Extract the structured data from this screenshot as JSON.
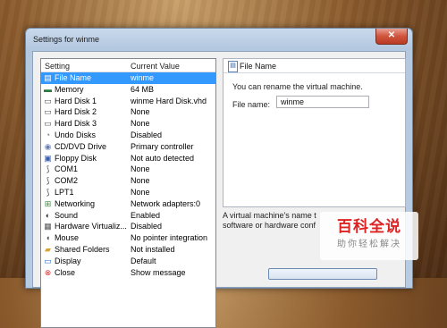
{
  "window": {
    "title": "Settings for winme",
    "close_label": "✕"
  },
  "list": {
    "headers": {
      "setting": "Setting",
      "value": "Current Value"
    },
    "rows": [
      {
        "label": "File Name",
        "value": "winme",
        "icon": "file-icon",
        "selected": true
      },
      {
        "label": "Memory",
        "value": "64 MB",
        "icon": "memory-icon"
      },
      {
        "label": "Hard Disk 1",
        "value": "winme Hard Disk.vhd",
        "icon": "hard-disk-icon"
      },
      {
        "label": "Hard Disk 2",
        "value": "None",
        "icon": "hard-disk-icon"
      },
      {
        "label": "Hard Disk 3",
        "value": "None",
        "icon": "hard-disk-icon"
      },
      {
        "label": "Undo Disks",
        "value": "Disabled",
        "icon": "undo-disk-icon"
      },
      {
        "label": "CD/DVD Drive",
        "value": "Primary controller",
        "icon": "cd-dvd-icon"
      },
      {
        "label": "Floppy Disk",
        "value": "Not auto detected",
        "icon": "floppy-icon"
      },
      {
        "label": "COM1",
        "value": "None",
        "icon": "com-port-icon"
      },
      {
        "label": "COM2",
        "value": "None",
        "icon": "com-port-icon"
      },
      {
        "label": "LPT1",
        "value": "None",
        "icon": "lpt-port-icon"
      },
      {
        "label": "Networking",
        "value": "Network adapters:0",
        "icon": "network-icon"
      },
      {
        "label": "Sound",
        "value": "Enabled",
        "icon": "sound-icon"
      },
      {
        "label": "Hardware Virtualiz...",
        "value": "Disabled",
        "icon": "hardware-virtualization-icon"
      },
      {
        "label": "Mouse",
        "value": "No pointer integration",
        "icon": "mouse-icon"
      },
      {
        "label": "Shared Folders",
        "value": "Not installed",
        "icon": "folder-icon"
      },
      {
        "label": "Display",
        "value": "Default",
        "icon": "display-icon"
      },
      {
        "label": "Close",
        "value": "Show message",
        "icon": "close-setting-icon"
      }
    ]
  },
  "detail": {
    "heading": "File Name",
    "description": "You can rename the virtual machine.",
    "field_label": "File name:",
    "field_value": "winme",
    "help_line1": "A virtual machine's name t",
    "help_line2": "software or hardware conf"
  },
  "watermark": {
    "title": "百科全说",
    "subtitle": "助你轻松解决"
  },
  "colors": {
    "selection": "#3399ff",
    "accent": "#d22222"
  }
}
